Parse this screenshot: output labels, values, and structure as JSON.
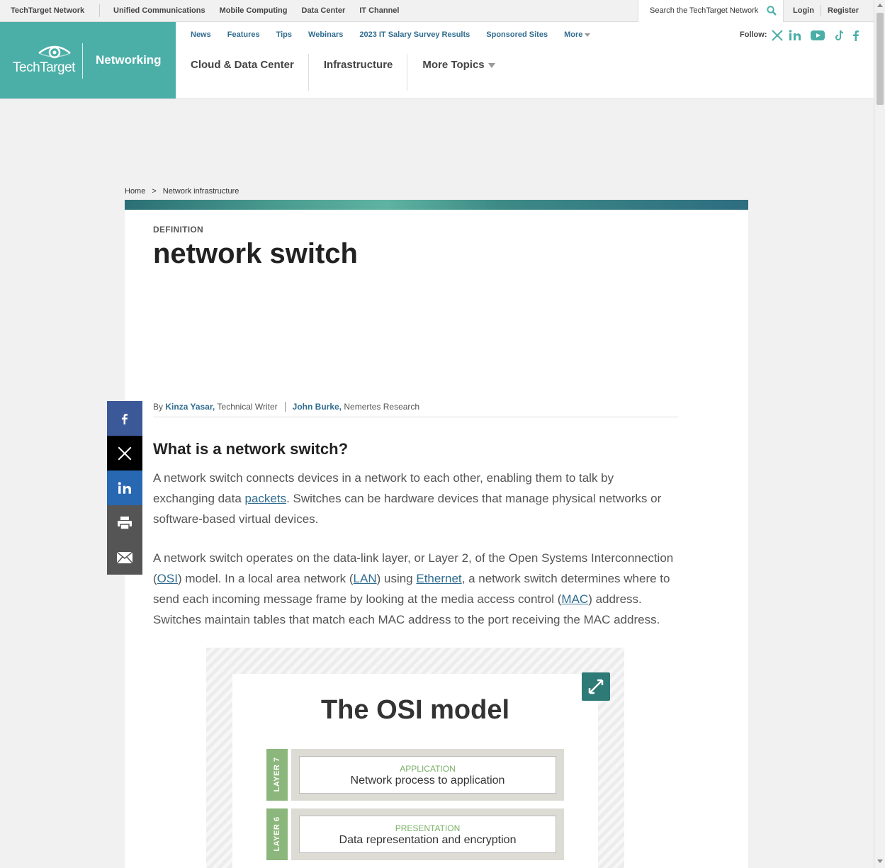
{
  "netbar": {
    "brand": "TechTarget Network",
    "links": [
      "Unified Communications",
      "Mobile Computing",
      "Data Center",
      "IT Channel"
    ],
    "search_placeholder": "Search the TechTarget Network",
    "login": "Login",
    "register": "Register"
  },
  "header": {
    "logo_text": "TechTarget",
    "site_name": "Networking",
    "subnav": [
      "News",
      "Features",
      "Tips",
      "Webinars",
      "2023 IT Salary Survey Results",
      "Sponsored Sites"
    ],
    "subnav_more": "More",
    "topics": [
      "Cloud & Data Center",
      "Infrastructure"
    ],
    "topics_more": "More Topics",
    "follow_label": "Follow:",
    "social_icons": [
      "x-icon",
      "linkedin-icon",
      "youtube-icon",
      "tiktok-icon",
      "facebook-icon"
    ],
    "brand_color": "#4bafa8",
    "link_color": "#316d90"
  },
  "breadcrumb": {
    "home": "Home",
    "separator": ">",
    "current": "Network infrastructure"
  },
  "article": {
    "label": "DEFINITION",
    "title": "network switch",
    "byline": {
      "by": "By",
      "author1": "Kinza Yasar,",
      "role1": "Technical Writer",
      "author2": "John Burke,",
      "role2": "Nemertes Research"
    },
    "heading": "What is a network switch?",
    "p1": {
      "a": "A network switch connects devices in a network to each other, enabling them to talk by exchanging data ",
      "link": "packets",
      "b": ". Switches can be hardware devices that manage physical networks or software-based virtual devices."
    },
    "p2": {
      "a": "A network switch operates on the data-link layer, or Layer 2, of the Open Systems Interconnection (",
      "osi": "OSI",
      "b": ") model. In a local area network (",
      "lan": "LAN",
      "c": ") using ",
      "ethernet": "Ethernet",
      "d": ", a network switch determines where to send each incoming message frame by looking at the media access control (",
      "mac": "MAC",
      "e": ") address. Switches maintain tables that match each MAC address to the port receiving the MAC address."
    }
  },
  "share": [
    "facebook-icon",
    "x-icon",
    "linkedin-icon",
    "print-icon",
    "email-icon"
  ],
  "figure": {
    "title": "The OSI model",
    "layers": [
      {
        "tag": "LAYER 7",
        "name": "APPLICATION",
        "desc": "Network process to application"
      },
      {
        "tag": "LAYER 6",
        "name": "PRESENTATION",
        "desc": "Data representation and encryption"
      }
    ]
  }
}
